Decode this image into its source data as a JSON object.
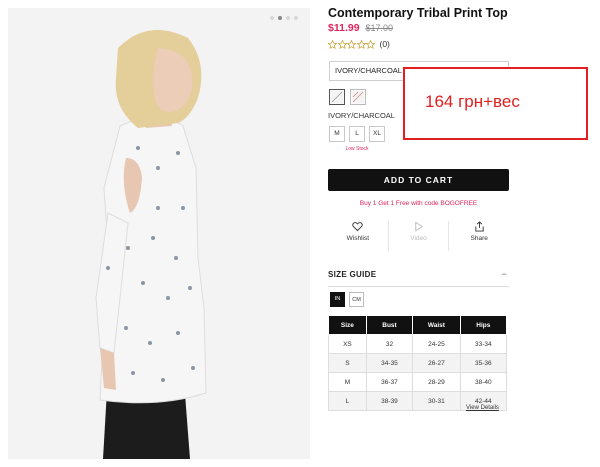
{
  "product": {
    "title": "Contemporary Tribal Print Top",
    "sale_price": "$11.99",
    "original_price": "$17.00",
    "review_count": "(0)",
    "rating": 0
  },
  "gallery": {
    "image_count": 4,
    "active_index": 1
  },
  "color_select": {
    "value": "IVORY/CHARCOAL"
  },
  "color_label": "IVORY/CHARCOAL",
  "sizes": [
    "M",
    "L",
    "XL"
  ],
  "low_stock": "Low Stock",
  "add_to_cart": "ADD TO CART",
  "promo": "Buy 1 Get 1 Free with code BOGOFREE",
  "actions": {
    "wishlist": "Wishlist",
    "video": "Video",
    "share": "Share"
  },
  "size_guide": {
    "title": "SIZE GUIDE",
    "toggle": "−",
    "units": [
      "IN",
      "CM"
    ],
    "headers": [
      "Size",
      "Bust",
      "Waist",
      "Hips"
    ],
    "rows": [
      [
        "XS",
        "32",
        "24-25",
        "33-34"
      ],
      [
        "S",
        "34-35",
        "26-27",
        "35-36"
      ],
      [
        "M",
        "36-37",
        "28-29",
        "38-40"
      ],
      [
        "L",
        "38-39",
        "30-31",
        "42-44"
      ]
    ],
    "view_details": "View Details"
  },
  "annotation": {
    "text": "164 грн+вес"
  },
  "colors": {
    "accent": "#e0245e",
    "annotation": "#e02020",
    "button": "#111111"
  }
}
